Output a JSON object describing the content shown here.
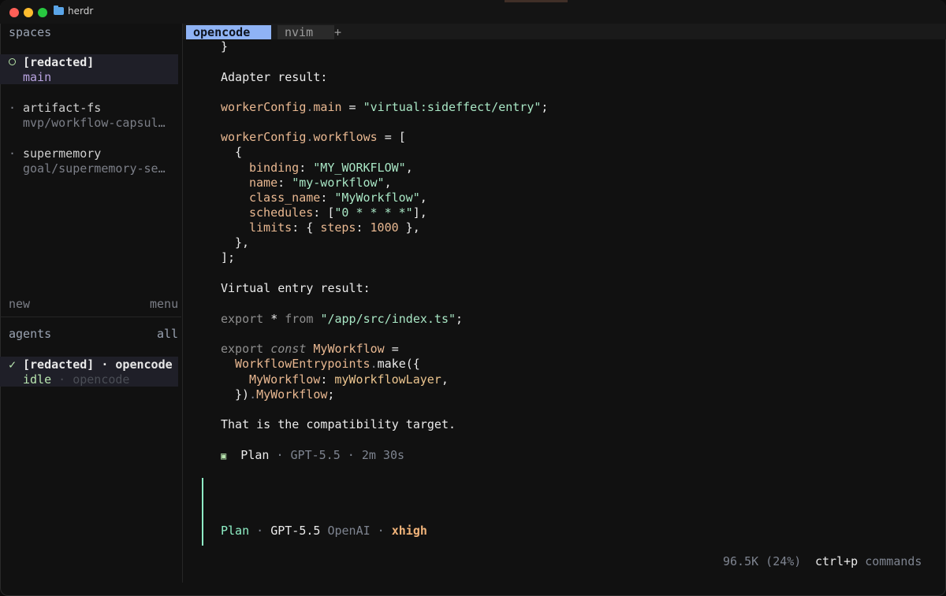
{
  "window": {
    "title": "herdr"
  },
  "sidebar": {
    "spaces_header": "spaces",
    "spaces": [
      {
        "name": "[redacted]",
        "detail": "main",
        "active": true
      },
      {
        "name": "artifact-fs",
        "detail": "mvp/workflow-capsul…",
        "active": false
      },
      {
        "name": "supermemory",
        "detail": "goal/supermemory-se…",
        "active": false
      }
    ],
    "new_label": "new",
    "menu_label": "menu",
    "agents_header": "agents",
    "agents_all": "all",
    "agent": {
      "check": "✓",
      "name": "[redacted] · opencode",
      "status": "idle",
      "sep": " · ",
      "tool": "opencode"
    },
    "collapse_glyph": "«"
  },
  "tabs": [
    {
      "label": "opencode",
      "active": true
    },
    {
      "label": "nvim",
      "active": false
    }
  ],
  "tab_add": "+",
  "code": {
    "l_brace_close": "}",
    "adapter_heading": "Adapter result:",
    "main_obj": "workerConfig",
    "dot": ".",
    "main_prop": "main",
    "eq": " = ",
    "main_val": "\"virtual:sideffect/entry\"",
    "semi": ";",
    "wf_prop": "workflows",
    "open_bracket": "[",
    "open_brace": "{",
    "binding_key": "binding",
    "binding_val": "\"MY_WORKFLOW\"",
    "name_key": "name",
    "name_val": "\"my-workflow\"",
    "class_key": "class_name",
    "class_val": "\"MyWorkflow\"",
    "sched_key": "schedules",
    "sched_val": "\"0 * * * *\"",
    "limits_key": "limits",
    "steps_key": "steps",
    "steps_val": "1000",
    "close_brace_comma": "},",
    "close_bracket": "];",
    "virtual_heading": "Virtual entry result:",
    "export_kw": "export",
    "star": " * ",
    "from_kw": "from ",
    "import_path": "\"/app/src/index.ts\"",
    "const_kw": "const",
    "mw_name": "MyWorkflow",
    "wep": "WorkflowEntrypoints",
    "make": "make",
    "mw_key": "MyWorkflow",
    "mw_layer": "myWorkflowLayer",
    "close_make": "})",
    "mw_access": "MyWorkflow",
    "summary": "That is the compatibility target."
  },
  "status_line": {
    "icon": "▣",
    "mode": "Plan",
    "model": "GPT-5.5",
    "time": "2m 30s"
  },
  "prompt": {
    "mode": "Plan",
    "model": "GPT-5.5",
    "provider": "OpenAI",
    "variant": "xhigh"
  },
  "footer": {
    "tokens": "96.5K (24%)",
    "shortcut": "ctrl+p",
    "commands": "commands"
  },
  "colors": {
    "accent_tab": "#8fb3f5",
    "prompt_bar": "#8ff0c6",
    "string": "#a8e6c4",
    "identifier": "#e9b891"
  }
}
